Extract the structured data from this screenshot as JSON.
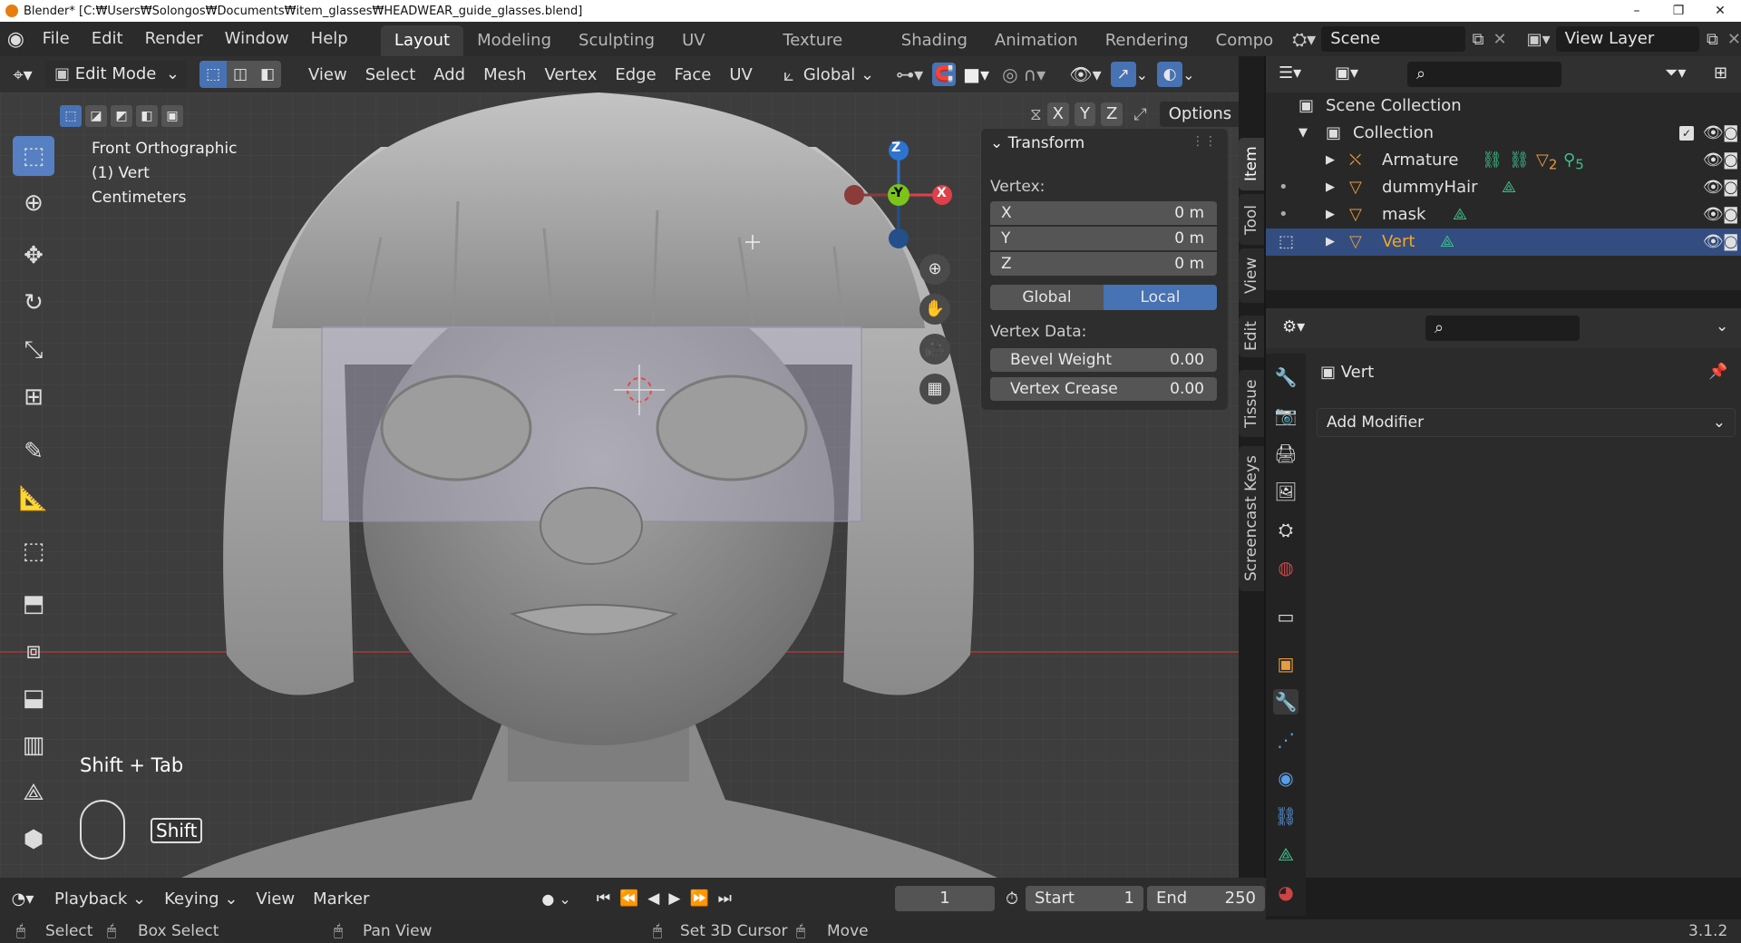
{
  "window_title": "Blender* [C:₩Users₩Solongos₩Documents₩item_glasses₩HEADWEAR_guide_glasses.blend]",
  "window_controls": {
    "minimize": "–",
    "maximize": "❐",
    "close": "✕"
  },
  "menus": [
    "File",
    "Edit",
    "Render",
    "Window",
    "Help"
  ],
  "workspace_tabs": [
    "Layout",
    "Modeling",
    "Sculpting",
    "UV Editing",
    "Texture Paint",
    "Shading",
    "Animation",
    "Rendering",
    "Compo"
  ],
  "active_workspace": "Layout",
  "scene": {
    "name": "Scene",
    "view_layer": "View Layer"
  },
  "viewport_header": {
    "mode": "Edit Mode",
    "menus": [
      "View",
      "Select",
      "Add",
      "Mesh",
      "Vertex",
      "Edge",
      "Face",
      "UV"
    ],
    "orientation": "Global",
    "options_label": "Options",
    "axes": [
      "X",
      "Y",
      "Z"
    ]
  },
  "viewport_overlay": {
    "view_name": "Front Orthographic",
    "object_info": "(1) Vert",
    "units": "Centimeters",
    "key_hint": "Shift + Tab",
    "key_badge": "Shift"
  },
  "gizmo": {
    "z": "Z",
    "y": "-Y",
    "x": "X"
  },
  "transform_panel": {
    "title": "Transform",
    "vertex_label": "Vertex:",
    "x_label": "X",
    "x_value": "0 m",
    "y_label": "Y",
    "y_value": "0 m",
    "z_label": "Z",
    "z_value": "0 m",
    "global_label": "Global",
    "local_label": "Local",
    "vertex_data_label": "Vertex Data:",
    "bevel_label": "Bevel Weight",
    "bevel_value": "0.00",
    "crease_label": "Vertex Crease",
    "crease_value": "0.00"
  },
  "sidebar_tabs": [
    "Item",
    "Tool",
    "View",
    "Edit",
    "Tissue",
    "Screencast Keys"
  ],
  "outliner": {
    "scene_collection": "Scene Collection",
    "collection": "Collection",
    "objects": [
      {
        "name": "Armature",
        "badge1": "2",
        "badge2": "5"
      },
      {
        "name": "dummyHair"
      },
      {
        "name": "mask"
      },
      {
        "name": "Vert"
      }
    ]
  },
  "properties": {
    "object_name": "Vert",
    "add_modifier_label": "Add Modifier"
  },
  "timeline": {
    "playback_label": "Playback",
    "keying_label": "Keying",
    "view_label": "View",
    "marker_label": "Marker",
    "current_frame": "1",
    "start_label": "Start",
    "start_value": "1",
    "end_label": "End",
    "end_value": "250"
  },
  "statusbar": {
    "select": "Select",
    "box_select": "Box Select",
    "pan_view": "Pan View",
    "set_cursor": "Set 3D Cursor",
    "move": "Move",
    "version": "3.1.2"
  },
  "colors": {
    "accent_blue": "#4772b3",
    "selected_row": "#334d80",
    "object_orange": "#e89b3c",
    "mesh_green": "#3fc08a",
    "axis_x": "#e0404a",
    "axis_y": "#7cc31a",
    "axis_z": "#2d74d0"
  }
}
